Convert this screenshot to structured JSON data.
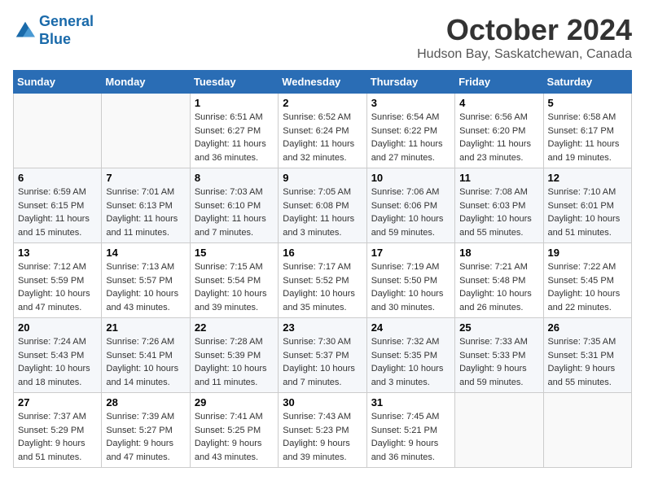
{
  "header": {
    "logo_line1": "General",
    "logo_line2": "Blue",
    "month": "October 2024",
    "location": "Hudson Bay, Saskatchewan, Canada"
  },
  "days_of_week": [
    "Sunday",
    "Monday",
    "Tuesday",
    "Wednesday",
    "Thursday",
    "Friday",
    "Saturday"
  ],
  "weeks": [
    [
      {
        "day": "",
        "sunrise": "",
        "sunset": "",
        "daylight": ""
      },
      {
        "day": "",
        "sunrise": "",
        "sunset": "",
        "daylight": ""
      },
      {
        "day": "1",
        "sunrise": "Sunrise: 6:51 AM",
        "sunset": "Sunset: 6:27 PM",
        "daylight": "Daylight: 11 hours and 36 minutes."
      },
      {
        "day": "2",
        "sunrise": "Sunrise: 6:52 AM",
        "sunset": "Sunset: 6:24 PM",
        "daylight": "Daylight: 11 hours and 32 minutes."
      },
      {
        "day": "3",
        "sunrise": "Sunrise: 6:54 AM",
        "sunset": "Sunset: 6:22 PM",
        "daylight": "Daylight: 11 hours and 27 minutes."
      },
      {
        "day": "4",
        "sunrise": "Sunrise: 6:56 AM",
        "sunset": "Sunset: 6:20 PM",
        "daylight": "Daylight: 11 hours and 23 minutes."
      },
      {
        "day": "5",
        "sunrise": "Sunrise: 6:58 AM",
        "sunset": "Sunset: 6:17 PM",
        "daylight": "Daylight: 11 hours and 19 minutes."
      }
    ],
    [
      {
        "day": "6",
        "sunrise": "Sunrise: 6:59 AM",
        "sunset": "Sunset: 6:15 PM",
        "daylight": "Daylight: 11 hours and 15 minutes."
      },
      {
        "day": "7",
        "sunrise": "Sunrise: 7:01 AM",
        "sunset": "Sunset: 6:13 PM",
        "daylight": "Daylight: 11 hours and 11 minutes."
      },
      {
        "day": "8",
        "sunrise": "Sunrise: 7:03 AM",
        "sunset": "Sunset: 6:10 PM",
        "daylight": "Daylight: 11 hours and 7 minutes."
      },
      {
        "day": "9",
        "sunrise": "Sunrise: 7:05 AM",
        "sunset": "Sunset: 6:08 PM",
        "daylight": "Daylight: 11 hours and 3 minutes."
      },
      {
        "day": "10",
        "sunrise": "Sunrise: 7:06 AM",
        "sunset": "Sunset: 6:06 PM",
        "daylight": "Daylight: 10 hours and 59 minutes."
      },
      {
        "day": "11",
        "sunrise": "Sunrise: 7:08 AM",
        "sunset": "Sunset: 6:03 PM",
        "daylight": "Daylight: 10 hours and 55 minutes."
      },
      {
        "day": "12",
        "sunrise": "Sunrise: 7:10 AM",
        "sunset": "Sunset: 6:01 PM",
        "daylight": "Daylight: 10 hours and 51 minutes."
      }
    ],
    [
      {
        "day": "13",
        "sunrise": "Sunrise: 7:12 AM",
        "sunset": "Sunset: 5:59 PM",
        "daylight": "Daylight: 10 hours and 47 minutes."
      },
      {
        "day": "14",
        "sunrise": "Sunrise: 7:13 AM",
        "sunset": "Sunset: 5:57 PM",
        "daylight": "Daylight: 10 hours and 43 minutes."
      },
      {
        "day": "15",
        "sunrise": "Sunrise: 7:15 AM",
        "sunset": "Sunset: 5:54 PM",
        "daylight": "Daylight: 10 hours and 39 minutes."
      },
      {
        "day": "16",
        "sunrise": "Sunrise: 7:17 AM",
        "sunset": "Sunset: 5:52 PM",
        "daylight": "Daylight: 10 hours and 35 minutes."
      },
      {
        "day": "17",
        "sunrise": "Sunrise: 7:19 AM",
        "sunset": "Sunset: 5:50 PM",
        "daylight": "Daylight: 10 hours and 30 minutes."
      },
      {
        "day": "18",
        "sunrise": "Sunrise: 7:21 AM",
        "sunset": "Sunset: 5:48 PM",
        "daylight": "Daylight: 10 hours and 26 minutes."
      },
      {
        "day": "19",
        "sunrise": "Sunrise: 7:22 AM",
        "sunset": "Sunset: 5:45 PM",
        "daylight": "Daylight: 10 hours and 22 minutes."
      }
    ],
    [
      {
        "day": "20",
        "sunrise": "Sunrise: 7:24 AM",
        "sunset": "Sunset: 5:43 PM",
        "daylight": "Daylight: 10 hours and 18 minutes."
      },
      {
        "day": "21",
        "sunrise": "Sunrise: 7:26 AM",
        "sunset": "Sunset: 5:41 PM",
        "daylight": "Daylight: 10 hours and 14 minutes."
      },
      {
        "day": "22",
        "sunrise": "Sunrise: 7:28 AM",
        "sunset": "Sunset: 5:39 PM",
        "daylight": "Daylight: 10 hours and 11 minutes."
      },
      {
        "day": "23",
        "sunrise": "Sunrise: 7:30 AM",
        "sunset": "Sunset: 5:37 PM",
        "daylight": "Daylight: 10 hours and 7 minutes."
      },
      {
        "day": "24",
        "sunrise": "Sunrise: 7:32 AM",
        "sunset": "Sunset: 5:35 PM",
        "daylight": "Daylight: 10 hours and 3 minutes."
      },
      {
        "day": "25",
        "sunrise": "Sunrise: 7:33 AM",
        "sunset": "Sunset: 5:33 PM",
        "daylight": "Daylight: 9 hours and 59 minutes."
      },
      {
        "day": "26",
        "sunrise": "Sunrise: 7:35 AM",
        "sunset": "Sunset: 5:31 PM",
        "daylight": "Daylight: 9 hours and 55 minutes."
      }
    ],
    [
      {
        "day": "27",
        "sunrise": "Sunrise: 7:37 AM",
        "sunset": "Sunset: 5:29 PM",
        "daylight": "Daylight: 9 hours and 51 minutes."
      },
      {
        "day": "28",
        "sunrise": "Sunrise: 7:39 AM",
        "sunset": "Sunset: 5:27 PM",
        "daylight": "Daylight: 9 hours and 47 minutes."
      },
      {
        "day": "29",
        "sunrise": "Sunrise: 7:41 AM",
        "sunset": "Sunset: 5:25 PM",
        "daylight": "Daylight: 9 hours and 43 minutes."
      },
      {
        "day": "30",
        "sunrise": "Sunrise: 7:43 AM",
        "sunset": "Sunset: 5:23 PM",
        "daylight": "Daylight: 9 hours and 39 minutes."
      },
      {
        "day": "31",
        "sunrise": "Sunrise: 7:45 AM",
        "sunset": "Sunset: 5:21 PM",
        "daylight": "Daylight: 9 hours and 36 minutes."
      },
      {
        "day": "",
        "sunrise": "",
        "sunset": "",
        "daylight": ""
      },
      {
        "day": "",
        "sunrise": "",
        "sunset": "",
        "daylight": ""
      }
    ]
  ]
}
